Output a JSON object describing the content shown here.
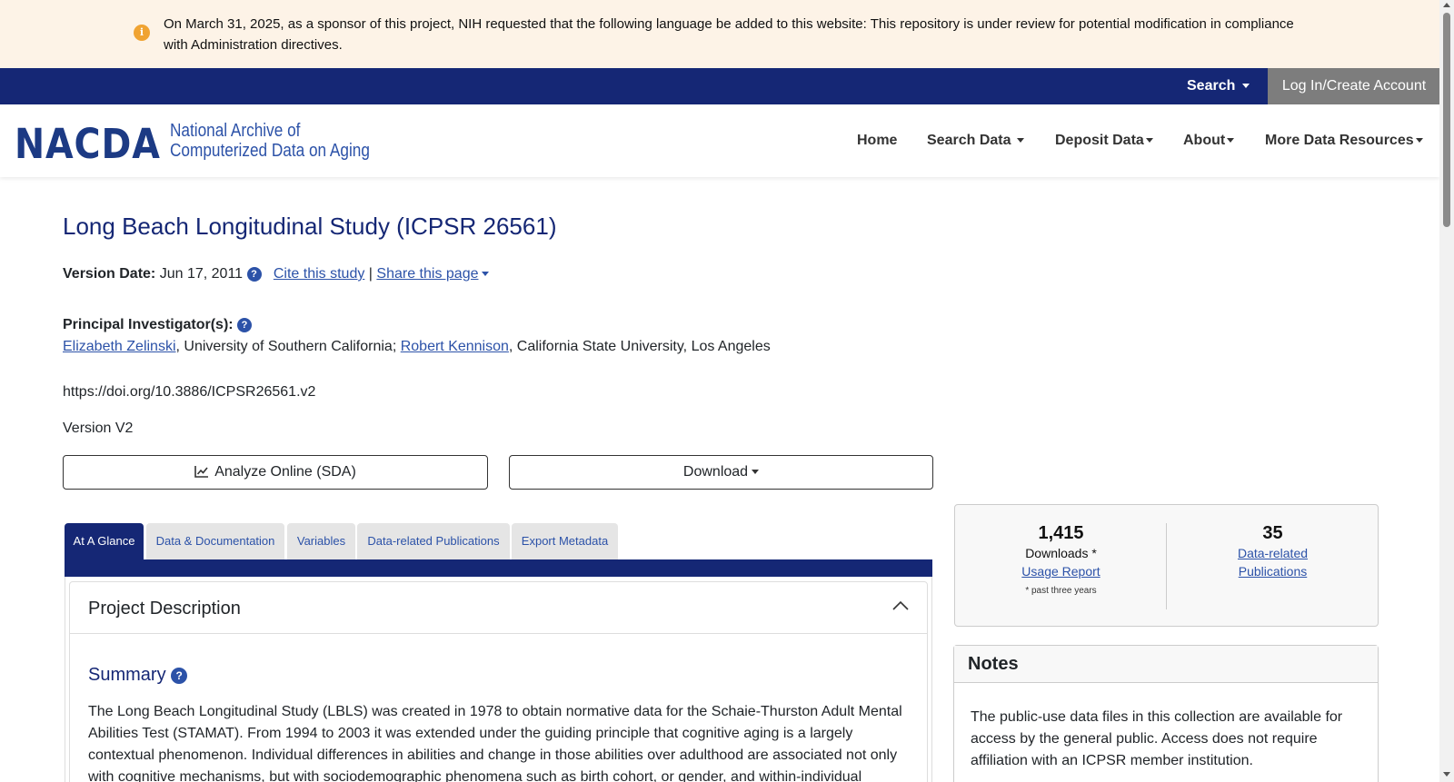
{
  "banner": {
    "icon": "info-icon",
    "text": "On March 31, 2025, as a sponsor of this project, NIH requested that the following language be added to this website: This repository is under review for potential modification in compliance with Administration directives."
  },
  "topbar": {
    "search_label": "Search",
    "login_label": "Log In/Create Account"
  },
  "logo": {
    "mark": "NACDA",
    "line1": "National Archive of",
    "line2": "Computerized Data on Aging"
  },
  "nav": {
    "home": "Home",
    "search_data": "Search Data",
    "deposit_data": "Deposit Data",
    "about": "About",
    "more": "More Data Resources"
  },
  "study": {
    "title": "Long Beach Longitudinal Study (ICPSR 26561)",
    "version_date_label": "Version Date:",
    "version_date": "Jun 17, 2011",
    "cite_label": "Cite this study",
    "separator": "|",
    "share_label": "Share this page",
    "pi_label": "Principal Investigator(s):",
    "pi1_name": "Elizabeth Zelinski",
    "pi1_affil": ", University of Southern California; ",
    "pi2_name": "Robert Kennison",
    "pi2_affil": ", California State University, Los Angeles",
    "doi": "https://doi.org/10.3886/ICPSR26561.v2",
    "version": "Version V2"
  },
  "buttons": {
    "analyze": "Analyze Online (SDA)",
    "download": "Download"
  },
  "tabs": [
    {
      "label": "At A Glance"
    },
    {
      "label": "Data & Documentation"
    },
    {
      "label": "Variables"
    },
    {
      "label": "Data-related Publications"
    },
    {
      "label": "Export Metadata"
    }
  ],
  "project": {
    "title": "Project Description",
    "summary_title": "Summary",
    "summary_text": "The Long Beach Longitudinal Study (LBLS) was created in 1978 to obtain normative data for the Schaie-Thurston Adult Mental Abilities Test (STAMAT). From 1994 to 2003 it was extended under the guiding principle that cognitive aging is a largely contextual phenomenon. Individual differences in abilities and change in those abilities over adulthood are associated not only with cognitive mechanisms, but with sociodemographic phenomena such as birth cohort, or gender, and within-individual"
  },
  "stats": {
    "downloads_num": "1,415",
    "downloads_label": "Downloads *",
    "usage_link": "Usage Report",
    "note": "* past three years",
    "pubs_num": "35",
    "pubs_link1": "Data-related",
    "pubs_link2": "Publications"
  },
  "notes": {
    "title": "Notes",
    "text": "The public-use data files in this collection are available for access by the general public. Access does not require affiliation with an ICPSR member institution."
  },
  "colors": {
    "navy": "#152775",
    "link": "#2c52a8",
    "banner_bg": "#fdf3e7",
    "info": "#f0a332"
  }
}
